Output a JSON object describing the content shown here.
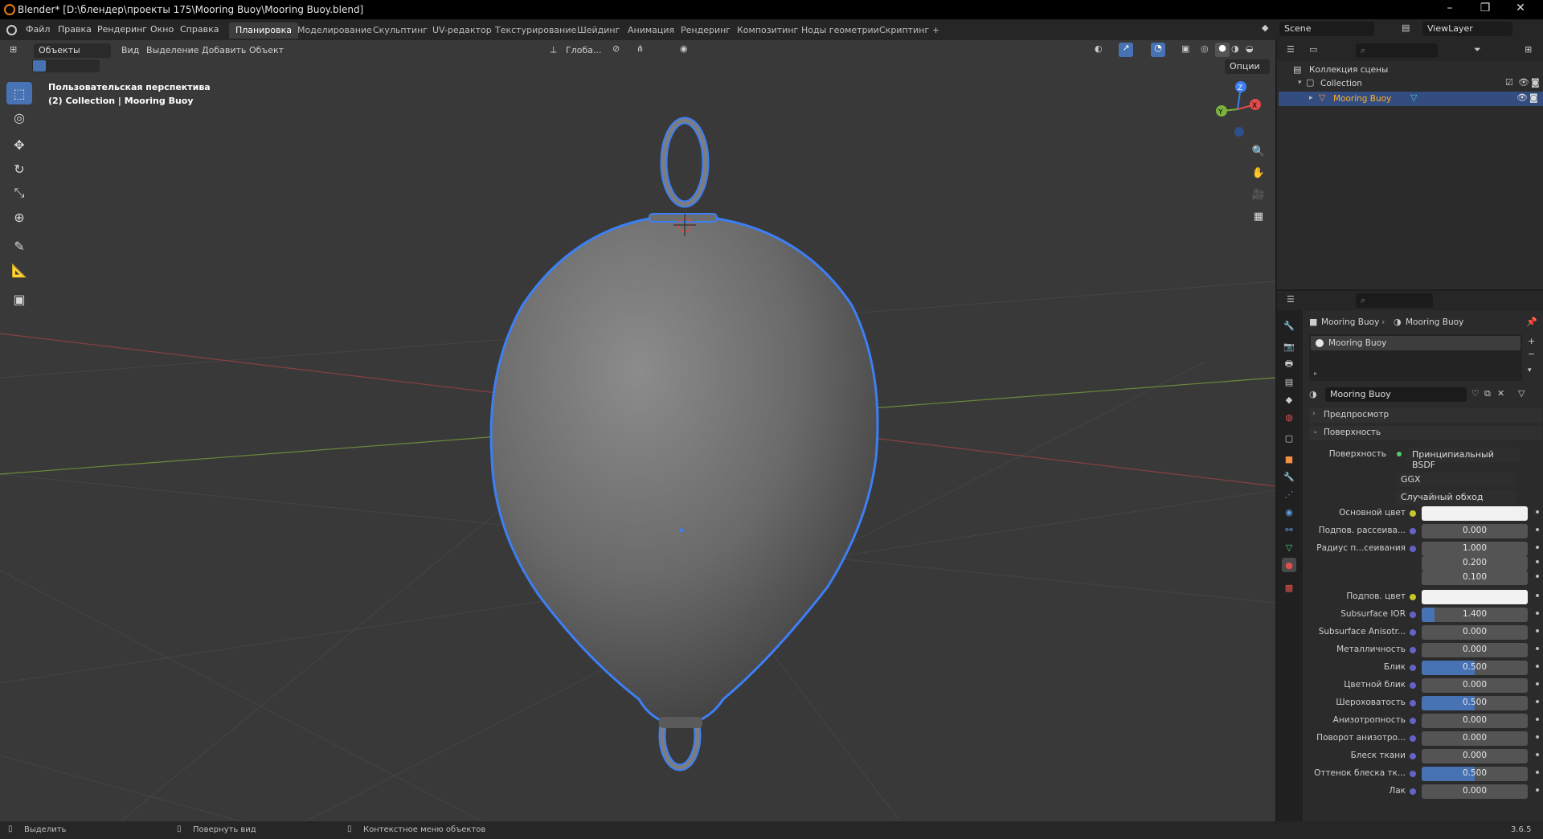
{
  "title_bar": {
    "title": "Blender* [D:\\блендер\\проекты 175\\Mooring Buoy\\Mooring Buoy.blend]",
    "controls": [
      "–",
      "❐",
      "✕"
    ]
  },
  "menu": {
    "items": [
      "Файл",
      "Правка",
      "Рендеринг",
      "Окно",
      "Справка"
    ],
    "workspaces": [
      "Планировка",
      "Моделирование",
      "Скульптинг",
      "UV-редактор",
      "Текстурирование",
      "Шейдинг",
      "Анимация",
      "Рендеринг",
      "Композитинг",
      "Ноды геометрии",
      "Скриптинг"
    ],
    "active_workspace_index": 0,
    "add_tab": "+",
    "scene": "Scene",
    "view_layer": "ViewLayer"
  },
  "viewport": {
    "mode": "Объекты",
    "menus": [
      "Вид",
      "Выделение",
      "Добавить",
      "Объект"
    ],
    "orientation": "Глоба...",
    "options": "Опции",
    "overlay_line1": "Пользовательская перспектива",
    "overlay_line2": "(2) Collection | Mooring Buoy",
    "gizmo": {
      "z": "Z",
      "y": "Y",
      "x": "X"
    }
  },
  "outliner": {
    "scene_collection": "Коллекция сцены",
    "collection": "Collection",
    "object": "Mooring Buoy"
  },
  "properties": {
    "breadcrumb": [
      "Mooring Buoy",
      "Mooring Buoy"
    ],
    "slot": "Mooring Buoy",
    "material_name": "Mooring Buoy",
    "panel_preview": "Предпросмотр",
    "panel_surface": "Поверхность",
    "surface_label": "Поверхность",
    "surface_value": "Принципиальный BSDF",
    "distribution": "GGX",
    "subsurface_method": "Случайный обход",
    "rows": [
      {
        "label": "Основной цвет",
        "value": "",
        "color": "#f2f2f2",
        "dot": "#c7c729"
      },
      {
        "label": "Подпов. рассеива...",
        "value": "0.000",
        "fill": 0
      },
      {
        "label": "Радиус п...сеивания",
        "value": "1.000",
        "fill": 0
      },
      {
        "label": "",
        "value": "0.200",
        "fill": 0
      },
      {
        "label": "",
        "value": "0.100",
        "fill": 0
      },
      {
        "label": "Подпов. цвет",
        "value": "",
        "color": "#f2f2f2",
        "dot": "#c7c729"
      },
      {
        "label": "Subsurface IOR",
        "value": "1.400",
        "fill": 0.12
      },
      {
        "label": "Subsurface Anisotr...",
        "value": "0.000",
        "fill": 0
      },
      {
        "label": "Металличность",
        "value": "0.000",
        "fill": 0
      },
      {
        "label": "Блик",
        "value": "0.500",
        "fill": 0.5
      },
      {
        "label": "Цветной блик",
        "value": "0.000",
        "fill": 0
      },
      {
        "label": "Шероховатость",
        "value": "0.500",
        "fill": 0.5
      },
      {
        "label": "Анизотропность",
        "value": "0.000",
        "fill": 0
      },
      {
        "label": "Поворот анизотро...",
        "value": "0.000",
        "fill": 0
      },
      {
        "label": "Блеск ткани",
        "value": "0.000",
        "fill": 0
      },
      {
        "label": "Оттенок блеска тк...",
        "value": "0.500",
        "fill": 0.5
      },
      {
        "label": "Лак",
        "value": "0.000",
        "fill": 0
      }
    ]
  },
  "statusbar": {
    "select": "Выделить",
    "rotate": "Повернуть вид",
    "context": "Контекстное меню объектов",
    "version": "3.6.5"
  },
  "colors": {
    "accent": "#4772b3",
    "selection_outline": "#3d7ff5",
    "viewport_bg": "#393939",
    "header_bg": "#262626"
  }
}
